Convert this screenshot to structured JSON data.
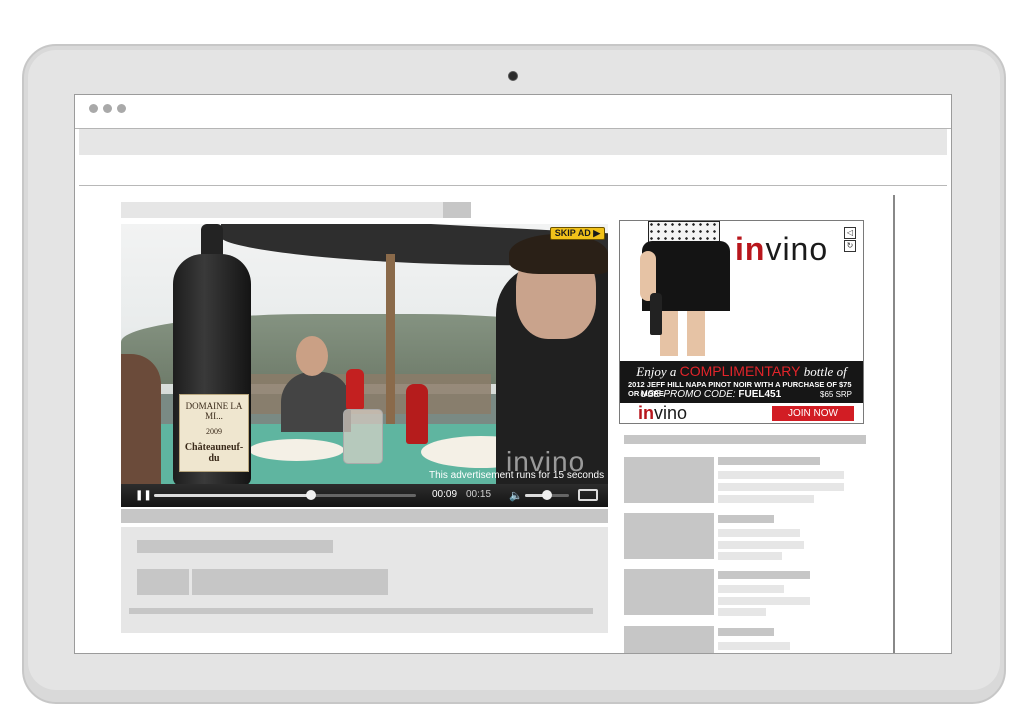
{
  "video": {
    "skip_label": "SKIP AD ▶",
    "ad_notice": "This advertisement runs for 15 seconds",
    "watermark": "invino",
    "bottle_label_top": "DOMAINE LA MI...",
    "bottle_label_main": "Châteauneuf-du",
    "bottle_label_year": "2009",
    "current_time": "00:09",
    "duration": "00:15",
    "progress_fraction": 0.6,
    "volume_fraction": 0.5
  },
  "ad": {
    "logo_prefix": "in",
    "logo_suffix": "vino",
    "enjoy_prefix": "Enjoy a",
    "enjoy_highlight": "COMPLIMENTARY",
    "enjoy_suffix": "bottle of",
    "offer_line": "2012 JEFF HILL NAPA PINOT NOIR  WITH A PURCHASE OF $75 OR MORE",
    "promo_prefix": "USE PROMO CODE:",
    "promo_code": "FUEL451",
    "srp": "$65 SRP",
    "join_label": "JOIN NOW",
    "brand_color": "#b8161c"
  },
  "icons": {
    "pause": "pause-icon",
    "volume": "volume-icon",
    "fullscreen": "fullscreen-icon",
    "ad_sound": "speaker-icon"
  }
}
